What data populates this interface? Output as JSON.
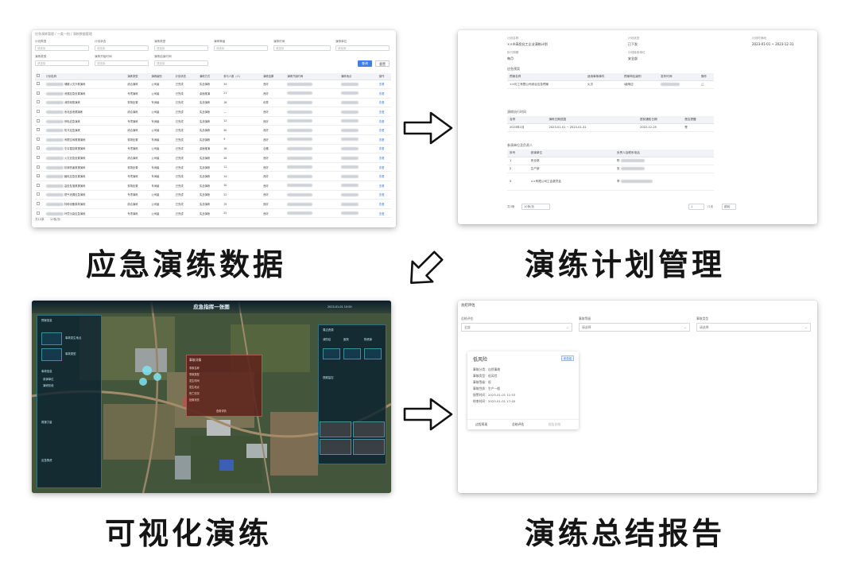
{
  "captions": {
    "top_left": "应急演练数据",
    "top_right": "演练计划管理",
    "bottom_left": "可视化演练",
    "bottom_right": "演练总结报告"
  },
  "panel_data": {
    "breadcrumb": "应急演练管理 / 一类一档 / 演练数据管理",
    "filters": [
      "计划类型",
      "计划状态",
      "演练类型",
      "演练等级",
      "演练时间",
      "演练单位"
    ],
    "filters_row2": [
      "演练类型",
      "演练开始时间",
      "演练结束时间"
    ],
    "placeholder": "请选择",
    "search_label": "查询",
    "reset_label": "重置",
    "columns": [
      "计划名称",
      "演练类型",
      "演练级别",
      "计划状态",
      "演练方式",
      "参与人数（人）",
      "演练结果",
      "演练开始时间",
      "演练地点",
      "操作"
    ],
    "rows": [
      [
        "储罐火灾扑救演练",
        "综合演练",
        "公司级",
        "已完成",
        "实战演练",
        "34",
        "良好"
      ],
      [
        "泄漏应急处置演练",
        "专项演练",
        "公司级",
        "已完成",
        "桌面推演",
        "21",
        "良好"
      ],
      [
        "消防疏散演练",
        "现场处置",
        "车间级",
        "已完成",
        "实战演练",
        "18",
        "优秀"
      ],
      [
        "危化品泄漏演练",
        "综合演练",
        "公司级",
        "已完成",
        "实战演练",
        "—",
        "良好"
      ],
      [
        "停电应急演练",
        "专项演练",
        "车间级",
        "已完成",
        "实战演练",
        "12",
        "良好"
      ],
      [
        "防汛应急演练",
        "综合演练",
        "公司级",
        "已完成",
        "实战演练",
        "40",
        "良好"
      ],
      [
        "有限空间救援演练",
        "现场处置",
        "车间级",
        "已完成",
        "实战演练",
        "9",
        "良好"
      ],
      [
        "中毒窒息救援演练",
        "专项演练",
        "公司级",
        "已完成",
        "桌面推演",
        "16",
        "合格"
      ],
      [
        "火灾应急处置演练",
        "综合演练",
        "公司级",
        "已完成",
        "实战演练",
        "28",
        "良好"
      ],
      [
        "机械伤害救援演练",
        "现场处置",
        "车间级",
        "已完成",
        "实战演练",
        "11",
        "良好"
      ],
      [
        "触电应急处置演练",
        "专项演练",
        "车间级",
        "已完成",
        "实战演练",
        "14",
        "良好"
      ],
      [
        "高处坠落救援演练",
        "现场处置",
        "车间级",
        "已完成",
        "实战演练",
        "10",
        "良好"
      ],
      [
        "燃气泄漏应急演练",
        "专项演练",
        "公司级",
        "已完成",
        "实战演练",
        "22",
        "良好"
      ],
      [
        "特种设备事故演练",
        "综合演练",
        "公司级",
        "已完成",
        "实战演练",
        "19",
        "良好"
      ],
      [
        "环境污染应急演练",
        "专项演练",
        "公司级",
        "已完成",
        "实战演练",
        "25",
        "良好"
      ]
    ],
    "op_label": "查看",
    "pager_text": "共15条",
    "page_size": "10条/页"
  },
  "panel_plan": {
    "fields": [
      {
        "label": "计划名称",
        "value": "××市高危化工企业演练计划"
      },
      {
        "label": "计划状态",
        "value": "已下发"
      },
      {
        "label": "计划时间段",
        "value": "2023-01-01 ~ 2023-12-31"
      },
      {
        "label": "执行周期",
        "value": "每月"
      },
      {
        "label": "计划接收单位",
        "value": "安全部"
      }
    ],
    "section_event": "应急预案",
    "event_cols": [
      "预案名称",
      "适用事故事件",
      "预案响应级别",
      "发布时间",
      "操作"
    ],
    "event_rows": [
      [
        "××化工有限公司综合应急预案",
        "火灾",
        "Ⅰ级响应"
      ]
    ],
    "section_time": "演练执行时间",
    "time_cols": [
      "名称",
      "演练日期范围",
      "提前通知日期",
      "是否提醒"
    ],
    "time_rows": [
      [
        "2023年1月",
        "2023-01-01 ~ 2023-01-31",
        "2022-12-25",
        "是"
      ]
    ],
    "section_units": "参演单位及负责人",
    "unit_cols": [
      "序号",
      "参演单位",
      "负责人及联系电话"
    ],
    "unit_rows": [
      [
        "1",
        "安全部",
        "陈"
      ],
      [
        "2",
        "生产部",
        "张"
      ],
      [
        "3",
        "××有限公司工会委员会",
        "李"
      ]
    ],
    "pager_total": "共3条",
    "page_size": "10条/页",
    "page_num": "1",
    "page_unit": "/1页",
    "jump_label": "跳转"
  },
  "panel_visual": {
    "title": "应急指挥一张图",
    "time_badge": "2023-01-01 10:00",
    "left_sections": [
      "预案信息",
      "事故信息",
      "救援力量",
      "应急物资"
    ],
    "left_items": [
      "事故发生地点",
      "事故类型",
      "参演单位",
      "演练阶段"
    ],
    "popup_title": "事故详情",
    "popup_rows": [
      "事故名称",
      "事故类型",
      "发生时间",
      "发生地点",
      "伤亡情况",
      "处置状态"
    ],
    "popup_button": "查看详情",
    "right_sections": [
      "周边资源",
      "视频监控"
    ],
    "right_items": [
      "消防站",
      "医院",
      "物资库"
    ]
  },
  "panel_report": {
    "header": "总结评估",
    "filters": [
      {
        "label": "总结评估",
        "value": "全部"
      },
      {
        "label": "事故等级",
        "value": "请选择"
      },
      {
        "label": "事故类型",
        "value": "请选择"
      }
    ],
    "card": {
      "title": "低风险",
      "tag": "未总结",
      "rows": [
        "事故分类：自然事故",
        "事故类型：低风险",
        "事故等级：低",
        "事故性质：生产一般",
        "接警时间：2023-01-01 11:53",
        "结束时间：2023-01-01 17:40"
      ],
      "buttons": [
        "过程再现",
        "总结评估",
        "报告总结"
      ]
    }
  }
}
